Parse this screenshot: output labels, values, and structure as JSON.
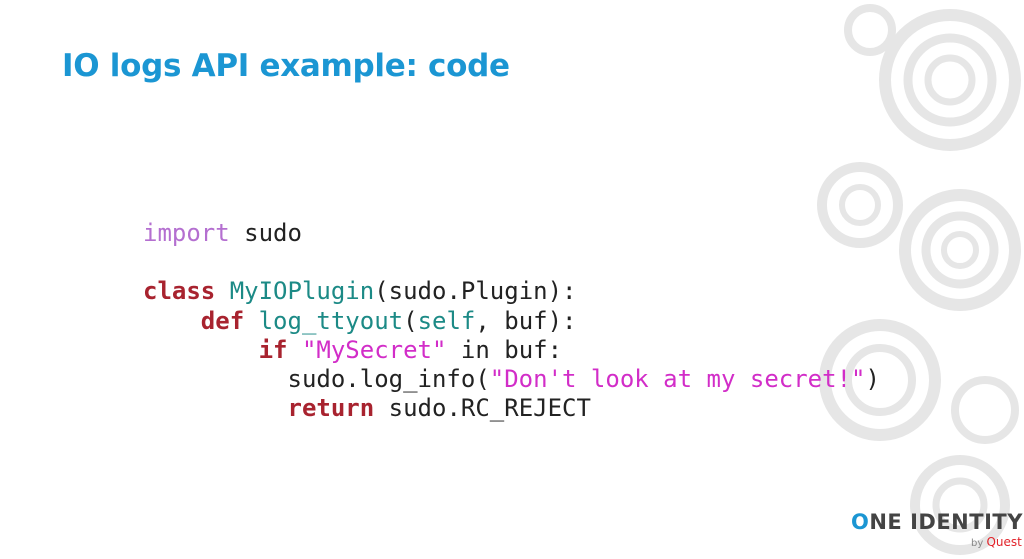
{
  "slide": {
    "title": "IO logs API example: code"
  },
  "code": {
    "lines": [
      [
        {
          "t": "import",
          "c": "kw-import"
        },
        {
          "t": " sudo",
          "c": "plain"
        }
      ],
      [],
      [
        {
          "t": "class",
          "c": "kw"
        },
        {
          "t": " ",
          "c": "plain"
        },
        {
          "t": "MyIOPlugin",
          "c": "name"
        },
        {
          "t": "(sudo.Plugin):",
          "c": "plain"
        }
      ],
      [
        {
          "t": "    ",
          "c": "plain"
        },
        {
          "t": "def",
          "c": "kw"
        },
        {
          "t": " ",
          "c": "plain"
        },
        {
          "t": "log_ttyout",
          "c": "name"
        },
        {
          "t": "(",
          "c": "plain"
        },
        {
          "t": "self",
          "c": "name"
        },
        {
          "t": ", buf):",
          "c": "plain"
        }
      ],
      [
        {
          "t": "        ",
          "c": "plain"
        },
        {
          "t": "if",
          "c": "kw"
        },
        {
          "t": " ",
          "c": "plain"
        },
        {
          "t": "\"MySecret\"",
          "c": "str"
        },
        {
          "t": " in buf:",
          "c": "plain"
        }
      ],
      [
        {
          "t": "          sudo.log_info(",
          "c": "plain"
        },
        {
          "t": "\"Don't look at my secret!\"",
          "c": "str"
        },
        {
          "t": ")",
          "c": "plain"
        }
      ],
      [
        {
          "t": "          ",
          "c": "plain"
        },
        {
          "t": "return",
          "c": "kw"
        },
        {
          "t": " sudo.RC_REJECT",
          "c": "plain"
        }
      ]
    ]
  },
  "logo": {
    "o": "O",
    "main": "NE IDENTITY",
    "by": "by",
    "brand": "Quest"
  },
  "colors": {
    "title": "#1b96d3",
    "keyword": "#a8232f",
    "name": "#1c8a86",
    "string": "#d22dc8",
    "import": "#b46fd0"
  }
}
